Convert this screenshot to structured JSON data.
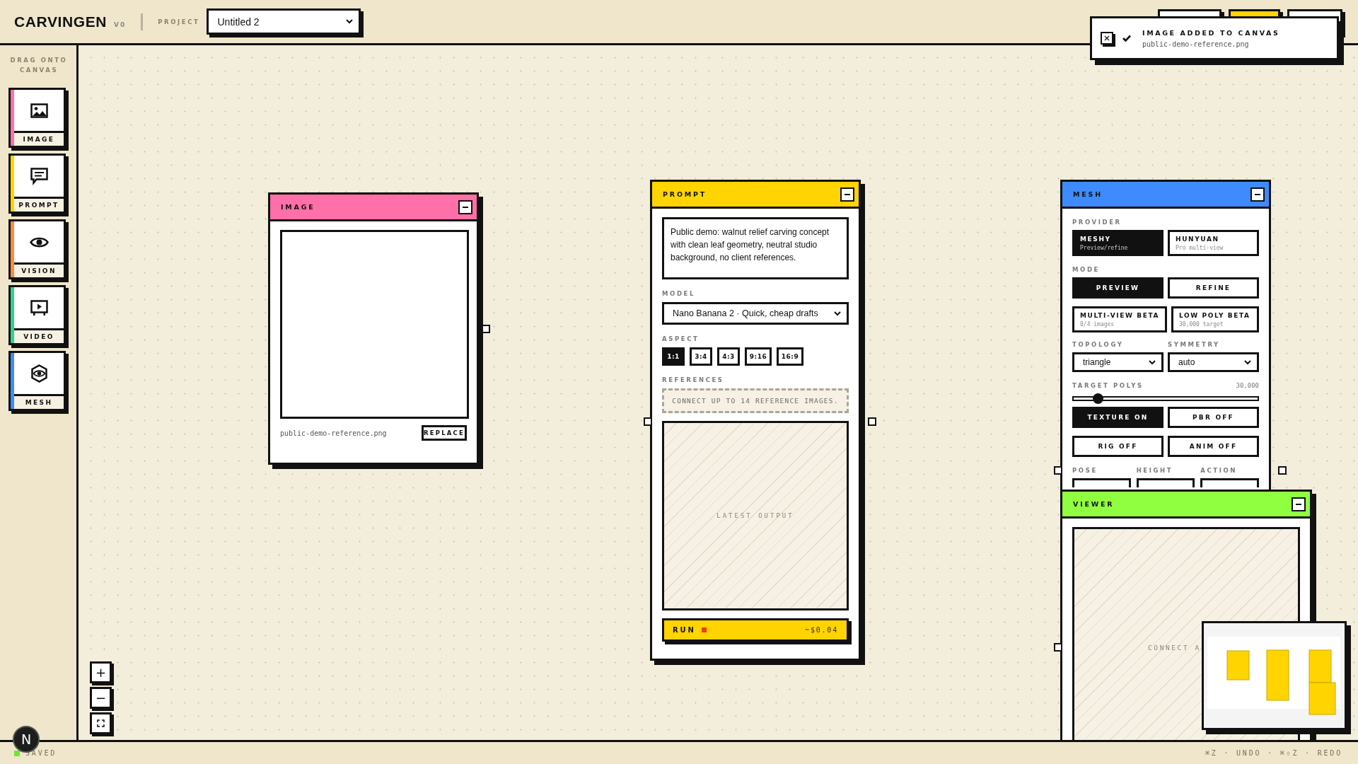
{
  "app": {
    "name": "CARVINGEN",
    "version": "V0",
    "project_label": "PROJECT",
    "project": "Untitled 2"
  },
  "toolbar_buttons": [
    {
      "selected": false
    },
    {
      "selected": true
    },
    {
      "selected": false
    }
  ],
  "toast": {
    "title": "IMAGE ADDED TO CANVAS",
    "message": "public-demo-reference.png"
  },
  "sidebar": {
    "title": "DRAG ONTO CANVAS",
    "items": [
      {
        "label": "IMAGE",
        "kind": "image",
        "color": "#ff6fa8"
      },
      {
        "label": "PROMPT",
        "kind": "prompt",
        "color": "#ffd400"
      },
      {
        "label": "VISION",
        "kind": "vision",
        "color": "#ff8a3d"
      },
      {
        "label": "VIDEO",
        "kind": "video",
        "color": "#2fd18b"
      },
      {
        "label": "MESH",
        "kind": "mesh",
        "color": "#3d8bff"
      }
    ]
  },
  "image_node": {
    "title": "IMAGE",
    "color": "#ff6fa8",
    "filename": "public-demo-reference.png",
    "button": "REPLACE"
  },
  "prompt_node": {
    "title": "PROMPT",
    "color": "#ffd400",
    "prompt": "Public demo: walnut relief carving concept with clean leaf geometry, neutral studio background, no client references.",
    "model_label": "MODEL",
    "model": "Nano Banana 2 · Quick, cheap drafts",
    "aspect_label": "ASPECT",
    "aspects": [
      {
        "label": "1:1",
        "selected": true
      },
      {
        "label": "3:4",
        "selected": false
      },
      {
        "label": "4:3",
        "selected": false
      },
      {
        "label": "9:16",
        "selected": false
      },
      {
        "label": "16:9",
        "selected": false
      }
    ],
    "references_label": "REFERENCES",
    "references_placeholder": "CONNECT UP TO 14 REFERENCE IMAGES.",
    "output_placeholder": "LATEST OUTPUT",
    "run": "RUN",
    "cost": "~$0.04"
  },
  "mesh_node": {
    "title": "MESH",
    "color": "#3d8bff",
    "provider_label": "PROVIDER",
    "providers": [
      {
        "name": "MESHY",
        "sub": "Preview/refine",
        "selected": true
      },
      {
        "name": "HUNYUAN",
        "sub": "Pro multi-view",
        "selected": false
      }
    ],
    "mode_label": "MODE",
    "modes": [
      {
        "label": "PREVIEW",
        "selected": true
      },
      {
        "label": "REFINE",
        "selected": false
      }
    ],
    "options": [
      {
        "name": "MULTI-VIEW BETA",
        "sub": "0/4 images",
        "selected": false
      },
      {
        "name": "LOW POLY BETA",
        "sub": "30,000 target",
        "selected": false
      }
    ],
    "topology_label": "TOPOLOGY",
    "topology": "triangle",
    "symmetry_label": "SYMMETRY",
    "symmetry": "auto",
    "target_polys": {
      "label": "TARGET POLYS",
      "value": "30,000",
      "level": 0.13
    },
    "toggles": [
      {
        "label": "TEXTURE ON",
        "on": true
      },
      {
        "label": "PBR OFF",
        "on": false
      },
      {
        "label": "RIG OFF",
        "on": false
      },
      {
        "label": "ANIM OFF",
        "on": false
      }
    ],
    "field_labels": [
      "POSE",
      "HEIGHT",
      "ACTION"
    ]
  },
  "viewer_node": {
    "title": "VIEWER",
    "color": "#8fff3f",
    "placeholder": "CONNECT A"
  },
  "zoom_controls": [
    "+",
    "−"
  ],
  "avatar": {
    "initial": "N"
  },
  "status_bar": {
    "saved": "SAVED",
    "shortcuts": "⌘Z · UNDO · ⌘⇧Z · REDO"
  }
}
